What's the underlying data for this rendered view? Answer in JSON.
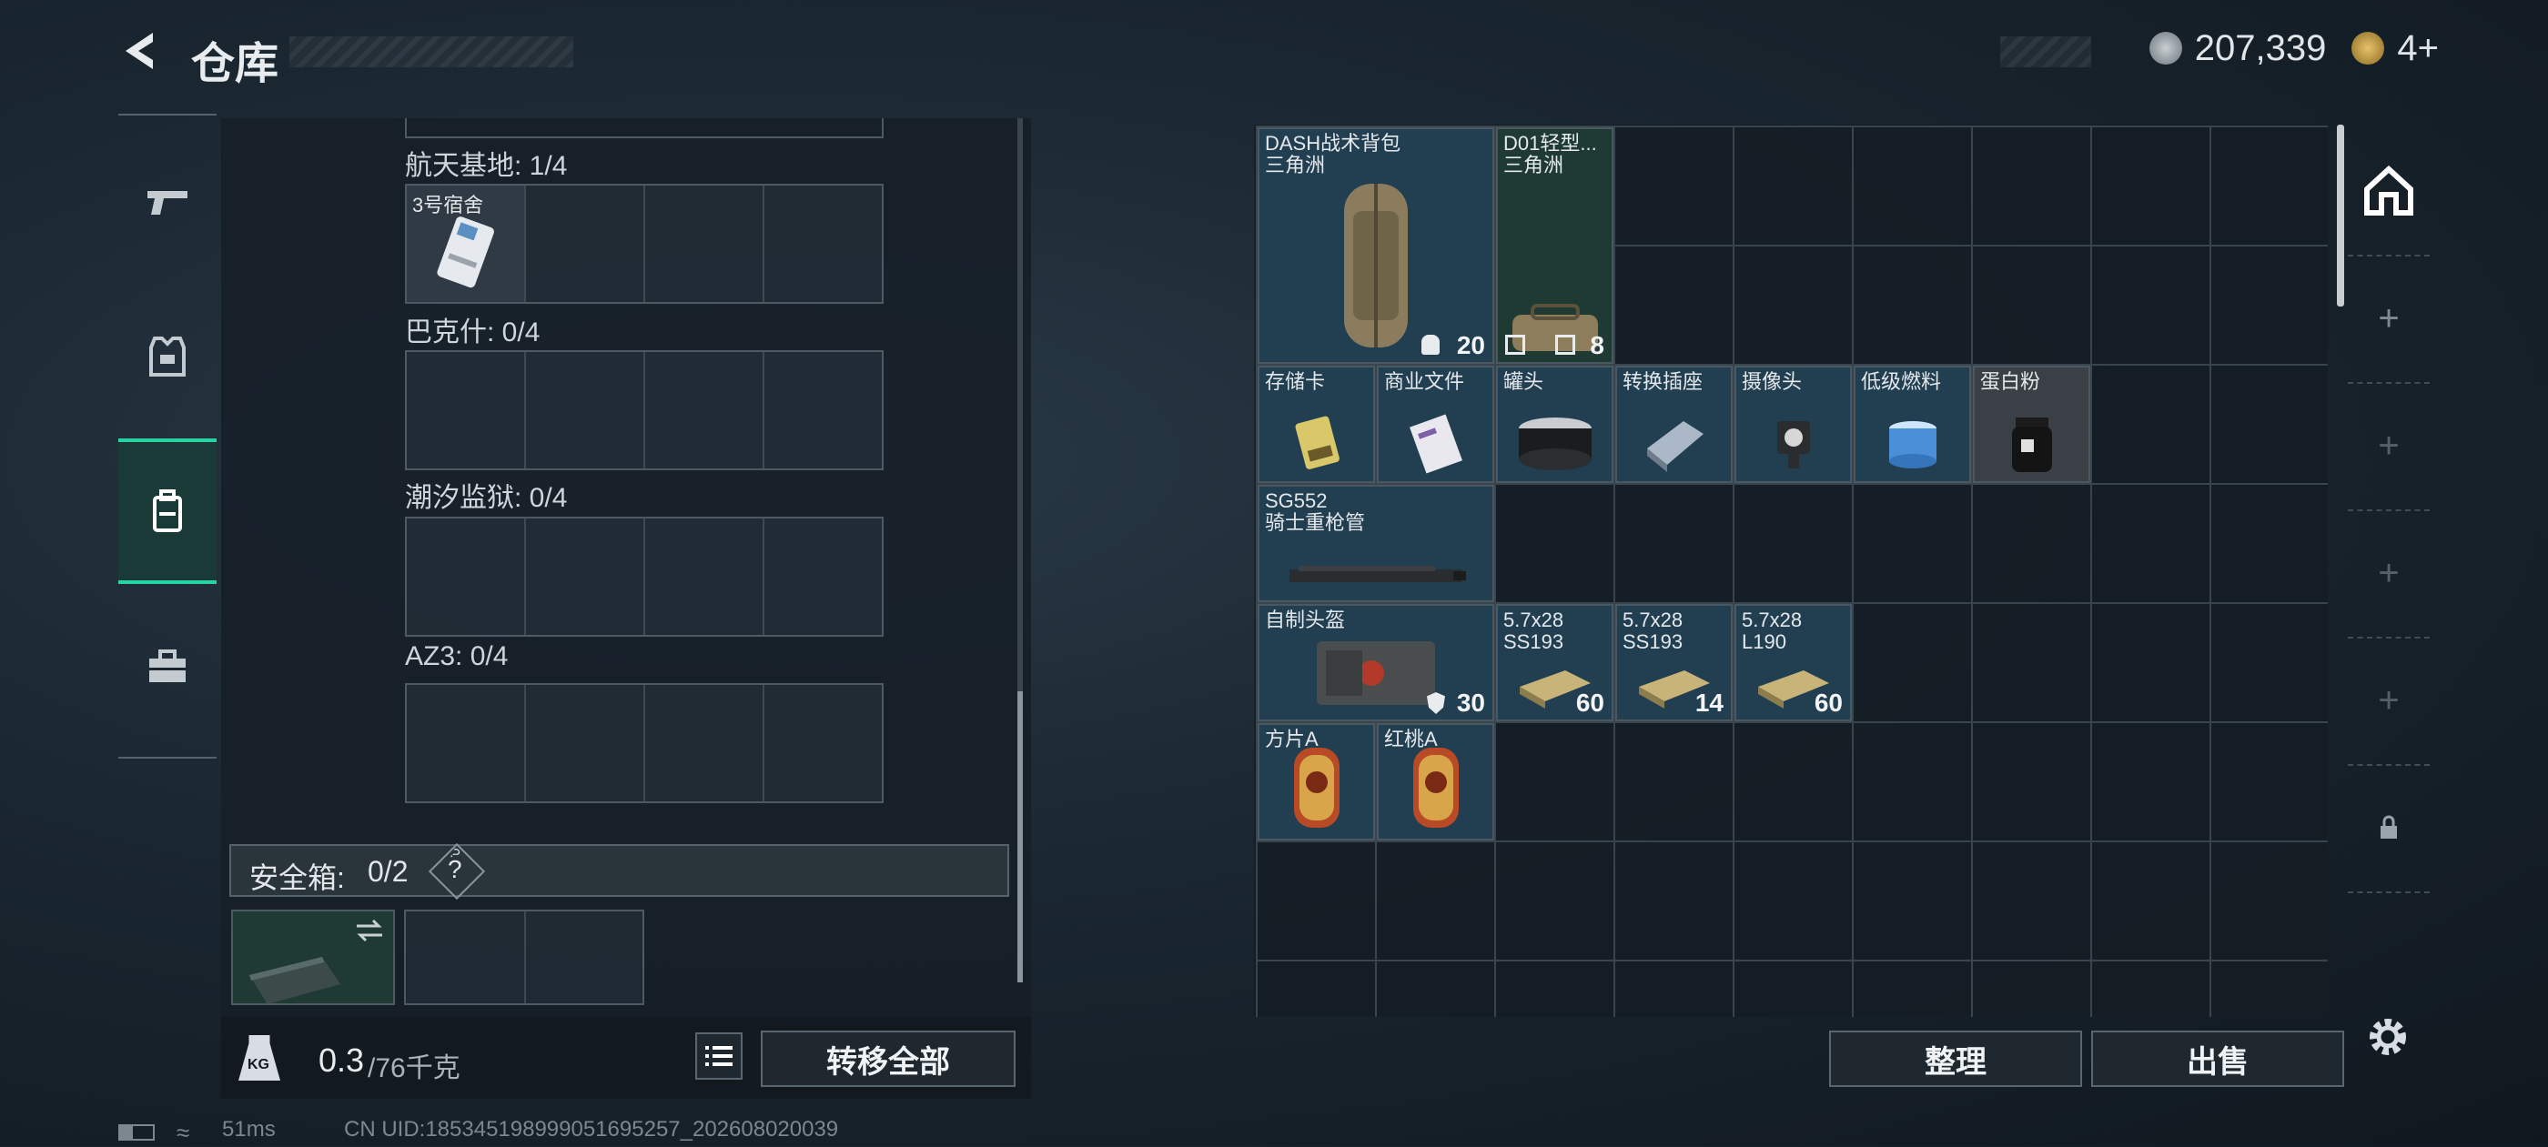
{
  "header": {
    "title": "仓库",
    "currency1": "207,339",
    "currency2": "4+"
  },
  "sidebar": {
    "items": [
      "weapons",
      "equipment",
      "backpack",
      "toolbox"
    ],
    "active": 2
  },
  "left_panel": {
    "sections": [
      {
        "label": "航天基地: 1/4",
        "items": [
          "3号宿舍"
        ]
      },
      {
        "label": "巴克什: 0/4",
        "items": []
      },
      {
        "label": "潮汐监狱: 0/4",
        "items": []
      },
      {
        "label": "AZ3: 0/4",
        "items": []
      }
    ],
    "safebox": {
      "label": "安全箱:",
      "count": "0/2",
      "help": "?"
    },
    "weight": {
      "current": "0.3",
      "max": "/76千克"
    },
    "transfer_all": "转移全部"
  },
  "inventory": {
    "items": [
      {
        "name": "DASH战术背包\n三角洲",
        "stats": [
          "20"
        ],
        "color": "blue"
      },
      {
        "name": "D01轻型...\n三角洲",
        "stats": [
          "",
          "8"
        ],
        "color": "green"
      },
      {
        "name": "存储卡",
        "color": "blue"
      },
      {
        "name": "商业文件",
        "color": "blue"
      },
      {
        "name": "罐头",
        "color": "blue"
      },
      {
        "name": "转换插座",
        "color": "blue"
      },
      {
        "name": "摄像头",
        "color": "blue"
      },
      {
        "name": "低级燃料",
        "color": "blue"
      },
      {
        "name": "蛋白粉",
        "color": "grey"
      },
      {
        "name": "SG552\n骑士重枪管",
        "color": "blue"
      },
      {
        "name": "自制头盔",
        "qty": "30",
        "color": "blue"
      },
      {
        "name": "5.7x28\nSS193",
        "qty": "60",
        "color": "blue"
      },
      {
        "name": "5.7x28\nSS193",
        "qty": "14",
        "color": "blue"
      },
      {
        "name": "5.7x28\nL190",
        "qty": "60",
        "color": "blue"
      },
      {
        "name": "方片A",
        "color": "blue"
      },
      {
        "name": "红桃A",
        "color": "blue"
      }
    ],
    "buttons": {
      "sort": "整理",
      "sell": "出售"
    }
  },
  "status": {
    "ping": "51ms",
    "uid": "CN UID:185345198999051695257_202608020039"
  },
  "colors": {
    "accent": "#27d3a0",
    "item_blue": "#223f52",
    "item_green": "#1f3a32"
  }
}
